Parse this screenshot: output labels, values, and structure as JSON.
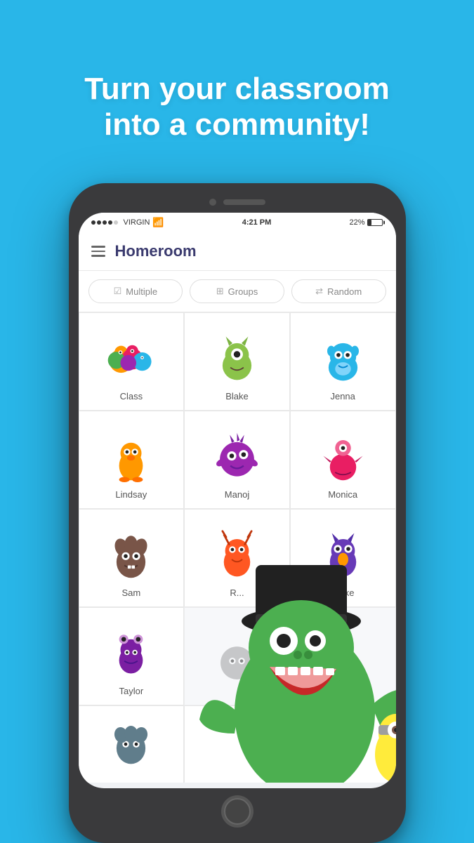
{
  "hero": {
    "line1": "Turn your classroom",
    "line2": "into a community!"
  },
  "status_bar": {
    "carrier": "VIRGIN",
    "time": "4:21 PM",
    "battery_percent": "22%"
  },
  "app_header": {
    "title": "Homeroom"
  },
  "filter_buttons": [
    {
      "id": "multiple",
      "label": "Multiple",
      "icon": "☑"
    },
    {
      "id": "groups",
      "label": "Groups",
      "icon": "⊞"
    },
    {
      "id": "random",
      "label": "Random",
      "icon": "⇄"
    }
  ],
  "students": [
    {
      "name": "Class",
      "color": "#ff6b9d",
      "row": 0,
      "col": 0
    },
    {
      "name": "Blake",
      "color": "#4caf50",
      "row": 0,
      "col": 1
    },
    {
      "name": "Jenna",
      "color": "#29b6e8",
      "row": 0,
      "col": 2
    },
    {
      "name": "Lindsay",
      "color": "#ff9800",
      "row": 1,
      "col": 0
    },
    {
      "name": "Manoj",
      "color": "#9c27b0",
      "row": 1,
      "col": 1
    },
    {
      "name": "Monica",
      "color": "#e91e63",
      "row": 1,
      "col": 2
    },
    {
      "name": "Sam",
      "color": "#795548",
      "row": 2,
      "col": 0
    },
    {
      "name": "R...",
      "color": "#ff5722",
      "row": 2,
      "col": 1
    },
    {
      "name": "Blake",
      "color": "#673ab7",
      "row": 2,
      "col": 2
    },
    {
      "name": "Taylor",
      "color": "#7b1fa2",
      "row": 3,
      "col": 0
    },
    {
      "name": "",
      "color": "#9e9e9e",
      "row": 3,
      "col": 1
    },
    {
      "name": "",
      "color": "#ff9800",
      "row": 3,
      "col": 2
    }
  ]
}
